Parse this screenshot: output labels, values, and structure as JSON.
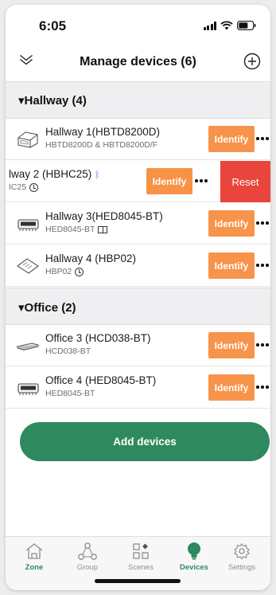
{
  "status": {
    "time": "6:05"
  },
  "nav": {
    "title": "Manage devices (6)",
    "collapse_icon": "chevron-double-down-icon",
    "add_icon": "plus-circle-icon"
  },
  "sections": [
    {
      "title": "▾Hallway (4)",
      "rows": [
        {
          "name": "Hallway 1(HBTD8200D)",
          "sub": "HBTD8200D & HBTD8200D/F",
          "sub_icon": "",
          "identify": "Identify"
        },
        {
          "name": "lway 2 (HBHC25)",
          "sub": "IC25",
          "sub_icon": "clock-icon",
          "identify": "Identify",
          "reset": "Reset",
          "name_icon": "bluetooth-icon"
        },
        {
          "name": "Hallway 3(HED8045-BT)",
          "sub": "HED8045-BT",
          "sub_icon": "book-icon",
          "identify": "Identify"
        },
        {
          "name": "Hallway 4 (HBP02)",
          "sub": "HBP02",
          "sub_icon": "clock-icon",
          "identify": "Identify"
        }
      ]
    },
    {
      "title": "▾Office (2)",
      "rows": [
        {
          "name": "Office 3 (HCD038-BT)",
          "sub": "HCD038-BT",
          "sub_icon": "",
          "identify": "Identify"
        },
        {
          "name": "Office 4 (HED8045-BT)",
          "sub": "HED8045-BT",
          "sub_icon": "",
          "identify": "Identify"
        }
      ]
    }
  ],
  "add_button": {
    "label": "Add devices"
  },
  "tabs": [
    {
      "label": "Zone",
      "icon": "home-icon",
      "active": false
    },
    {
      "label": "Group",
      "icon": "group-icon",
      "active": false
    },
    {
      "label": "Scenes",
      "icon": "scenes-icon",
      "active": false
    },
    {
      "label": "Devices",
      "icon": "bulb-icon",
      "active": true
    },
    {
      "label": "Settings",
      "icon": "gear-icon",
      "active": false
    }
  ],
  "colors": {
    "accent": "#2e8a5e",
    "identify": "#f7934a",
    "reset": "#e8453c",
    "section_bg": "#efeff1"
  }
}
